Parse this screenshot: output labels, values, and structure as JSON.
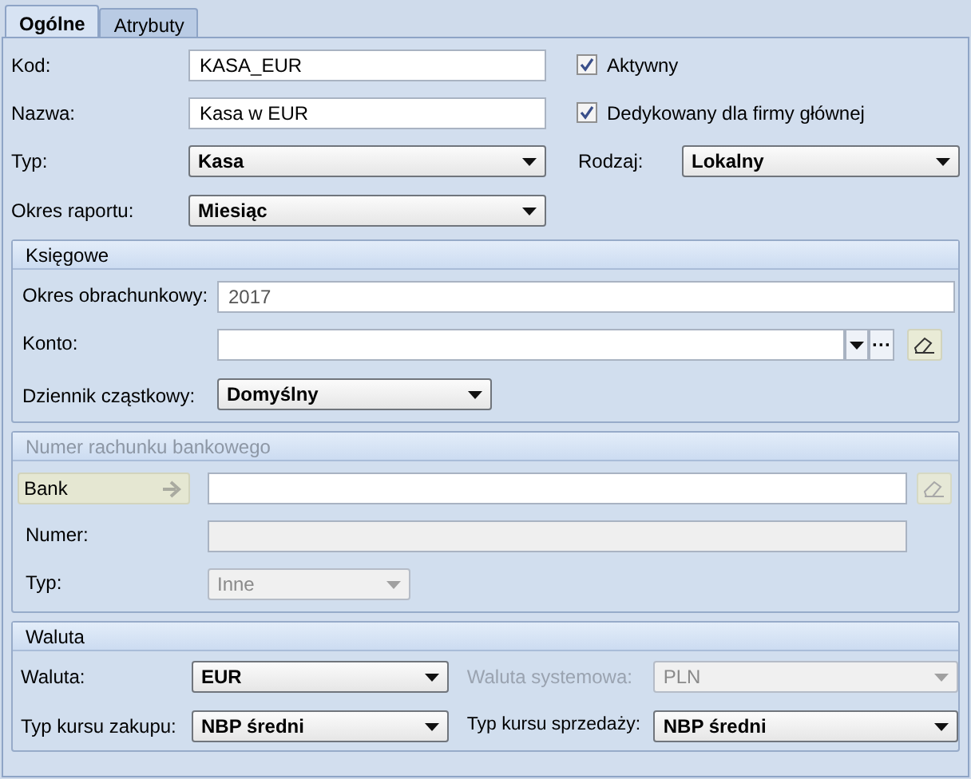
{
  "tabs": [
    {
      "label": "Ogólne",
      "selected": true
    },
    {
      "label": "Atrybuty",
      "selected": false
    }
  ],
  "general": {
    "kod": {
      "label": "Kod:",
      "value": "KASA_EUR"
    },
    "aktywny": {
      "label": "Aktywny",
      "checked": true
    },
    "nazwa": {
      "label": "Nazwa:",
      "value": "Kasa w EUR"
    },
    "dedykowany": {
      "label": "Dedykowany dla firmy głównej",
      "checked": true
    },
    "typ": {
      "label": "Typ:",
      "value": "Kasa"
    },
    "rodzaj": {
      "label": "Rodzaj:",
      "value": "Lokalny"
    },
    "okres_raportu": {
      "label": "Okres raportu:",
      "value": "Miesiąc"
    }
  },
  "ksiegowe": {
    "title": "Księgowe",
    "okres": {
      "label": "Okres obrachunkowy:",
      "value": "2017"
    },
    "konto": {
      "label": "Konto:",
      "dots": "···"
    },
    "dziennik": {
      "label": "Dziennik cząstkowy:",
      "value": "Domyślny"
    }
  },
  "rachunek": {
    "title": "Numer rachunku bankowego",
    "disabled": true,
    "bank": {
      "label": "Bank"
    },
    "numer": {
      "label": "Numer:"
    },
    "typ": {
      "label": "Typ:",
      "value": "Inne"
    }
  },
  "waluta": {
    "title": "Waluta",
    "waluta": {
      "label": "Waluta:",
      "value": "EUR"
    },
    "systemowa": {
      "label": "Waluta systemowa:",
      "value": "PLN",
      "disabled": true
    },
    "zakup": {
      "label": "Typ kursu zakupu:",
      "value": "NBP średni"
    },
    "sprzedaz": {
      "label": "Typ kursu sprzedaży:",
      "value": "NBP średni"
    }
  }
}
